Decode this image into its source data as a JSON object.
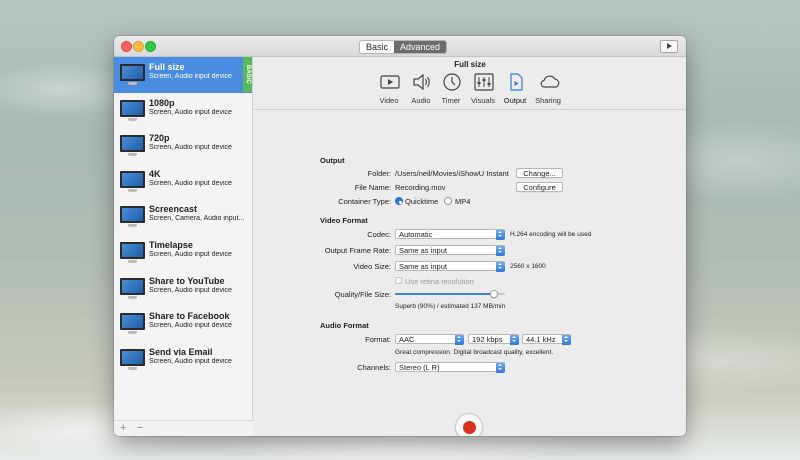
{
  "window": {
    "mode_tabs": [
      "Basic",
      "Advanced"
    ],
    "active_mode": "Advanced"
  },
  "sidebar": {
    "basic_tag": "BASIC",
    "presets": [
      {
        "name": "Full size",
        "desc": "Screen, Audio input device"
      },
      {
        "name": "1080p",
        "desc": "Screen, Audio input device"
      },
      {
        "name": "720p",
        "desc": "Screen, Audio input device"
      },
      {
        "name": "4K",
        "desc": "Screen, Audio input device"
      },
      {
        "name": "Screencast",
        "desc": "Screen, Camera, Audio input..."
      },
      {
        "name": "Timelapse",
        "desc": "Screen, Audio input device"
      },
      {
        "name": "Share to YouTube",
        "desc": "Screen, Audio input device"
      },
      {
        "name": "Share to Facebook",
        "desc": "Screen, Audio input device"
      },
      {
        "name": "Send via Email",
        "desc": "Screen, Audio input device"
      }
    ],
    "add_label": "+",
    "remove_label": "−"
  },
  "toolbar": {
    "title": "Full size",
    "tools": [
      {
        "label": "Video",
        "icon": "video-icon"
      },
      {
        "label": "Audio",
        "icon": "speaker-icon"
      },
      {
        "label": "Timer",
        "icon": "clock-icon"
      },
      {
        "label": "Visuals",
        "icon": "sliders-icon"
      },
      {
        "label": "Output",
        "icon": "document-icon"
      },
      {
        "label": "Sharing",
        "icon": "cloud-icon"
      }
    ],
    "active_tool": "Output"
  },
  "output": {
    "section": "Output",
    "folder_label": "Folder:",
    "folder_value": "/Users/neil/Movies/iShowU Instant",
    "change_button": "Change...",
    "filename_label": "File Name:",
    "filename_value": "Recording.mov",
    "configure_button": "Configure",
    "container_label": "Container Type:",
    "container_options": [
      "Quicktime",
      "MP4"
    ],
    "container_selected": "Quicktime"
  },
  "video": {
    "section": "Video Format",
    "codec_label": "Codec:",
    "codec_value": "Automatic",
    "codec_note": "H.264 encoding will be used",
    "framerate_label": "Output Frame Rate:",
    "framerate_value": "Same as input",
    "size_label": "Video Size:",
    "size_value": "Same as input",
    "size_note": "2560 x 1600",
    "retina_label": "Use retina resolution",
    "retina_checked": false,
    "quality_label": "Quality/File Size:",
    "quality_percent": 90,
    "quality_note": "Superb (90%) / estimated 137 MB/min"
  },
  "audio": {
    "section": "Audio Format",
    "format_label": "Format:",
    "format_value": "AAC",
    "bitrate_value": "192 kbps",
    "samplerate_value": "44.1 kHz",
    "format_note": "Great compression. Digital broadcast quality, excellent.",
    "channels_label": "Channels:",
    "channels_value": "Stereo (L R)"
  },
  "colors": {
    "accent": "#2f7be0",
    "selection": "#4a8de0",
    "basic_tag": "#5cb85c",
    "record": "#d9301f"
  }
}
